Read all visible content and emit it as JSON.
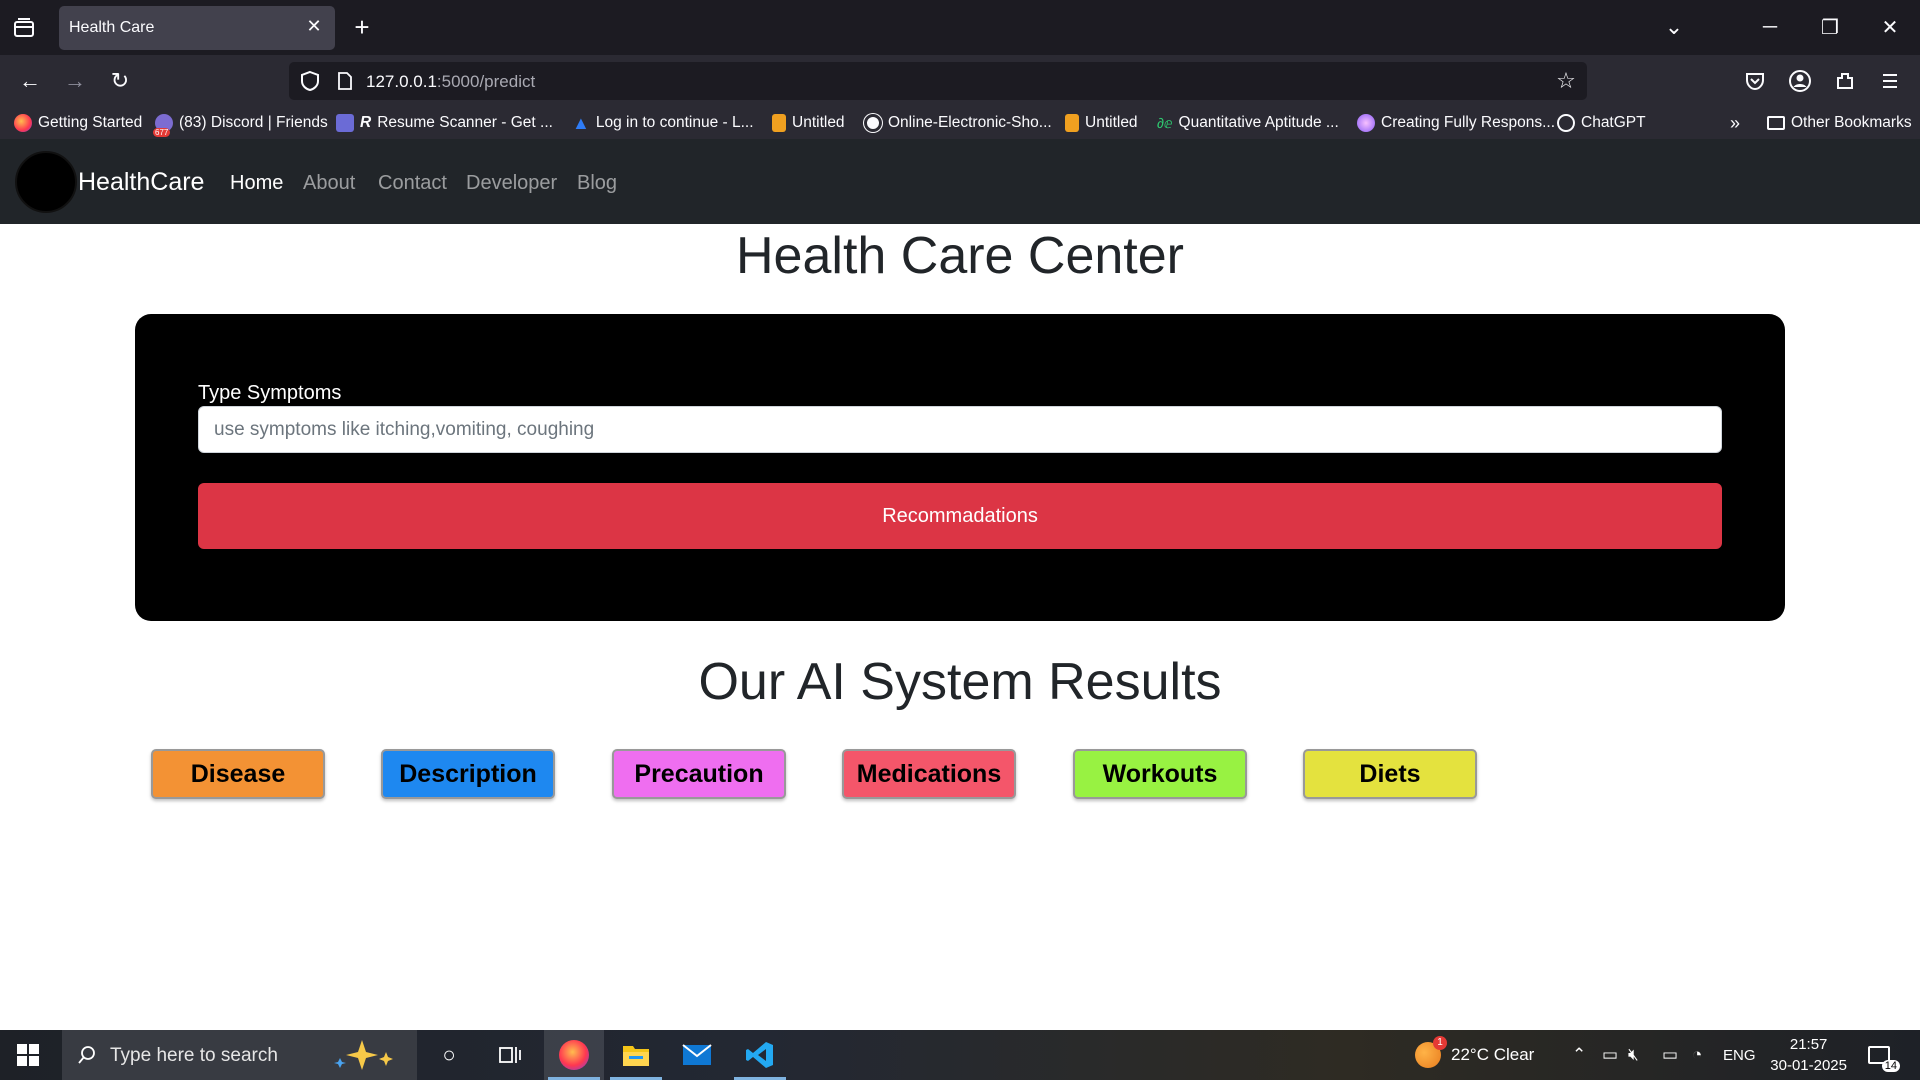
{
  "browser": {
    "tab_title": "Health Care",
    "url_host": "127.0.0.1",
    "url_rest": ":5000/predict",
    "bookmarks": [
      "Getting Started",
      "(83) Discord | Friends",
      "Resume Scanner - Get ...",
      "Log in to continue - L...",
      "Untitled",
      "Online-Electronic-Sho...",
      "Untitled",
      "Quantitative Aptitude ...",
      "Creating Fully Respons...",
      "ChatGPT"
    ],
    "other_bookmarks": "Other Bookmarks",
    "discord_badge": "677"
  },
  "site": {
    "brand": "HealthCare",
    "nav": [
      "Home",
      "About",
      "Contact",
      "Developer",
      "Blog"
    ]
  },
  "main": {
    "title": "Health Care Center",
    "symptoms_label": "Type Symptoms",
    "symptoms_placeholder": "use symptoms like itching,vomiting, coughing",
    "recommend_button": "Recommadations",
    "results_title": "Our AI System Results",
    "results": [
      {
        "label": "Disease",
        "color": "#f39234"
      },
      {
        "label": "Description",
        "color": "#1e88f0"
      },
      {
        "label": "Precaution",
        "color": "#ef6ef0"
      },
      {
        "label": "Medications",
        "color": "#f4566a"
      },
      {
        "label": "Workouts",
        "color": "#98f242"
      },
      {
        "label": "Diets",
        "color": "#e4e23e"
      }
    ]
  },
  "taskbar": {
    "search_placeholder": "Type here to search",
    "weather_temp": "22°C",
    "weather_text": "Clear",
    "weather_badge": "1",
    "language": "ENG",
    "time": "21:57",
    "date": "30-01-2025",
    "notification_count": "14"
  }
}
